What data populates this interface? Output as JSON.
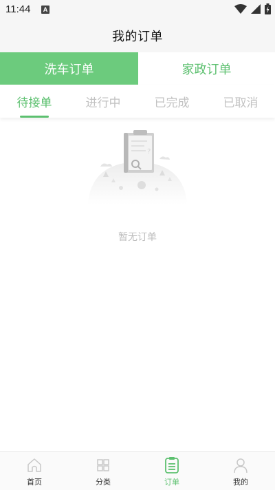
{
  "status_bar": {
    "time": "11:44",
    "notification_icon": "A"
  },
  "header": {
    "title": "我的订单"
  },
  "service_tabs": [
    {
      "label": "洗车订单",
      "active": true
    },
    {
      "label": "家政订单",
      "active": false
    }
  ],
  "status_tabs": [
    {
      "label": "待接单",
      "active": true
    },
    {
      "label": "进行中",
      "active": false
    },
    {
      "label": "已完成",
      "active": false
    },
    {
      "label": "已取消",
      "active": false
    }
  ],
  "empty_state": {
    "message": "暂无订单",
    "icon": "clipboard-search-icon"
  },
  "bottom_nav": [
    {
      "label": "首页",
      "icon": "home-icon",
      "active": false
    },
    {
      "label": "分类",
      "icon": "grid-icon",
      "active": false
    },
    {
      "label": "订单",
      "icon": "order-list-icon",
      "active": true
    },
    {
      "label": "我的",
      "icon": "user-icon",
      "active": false
    }
  ],
  "colors": {
    "accent": "#5cc06f",
    "accent_fill": "#6ccb7d",
    "muted_text": "#c2c2c2"
  }
}
